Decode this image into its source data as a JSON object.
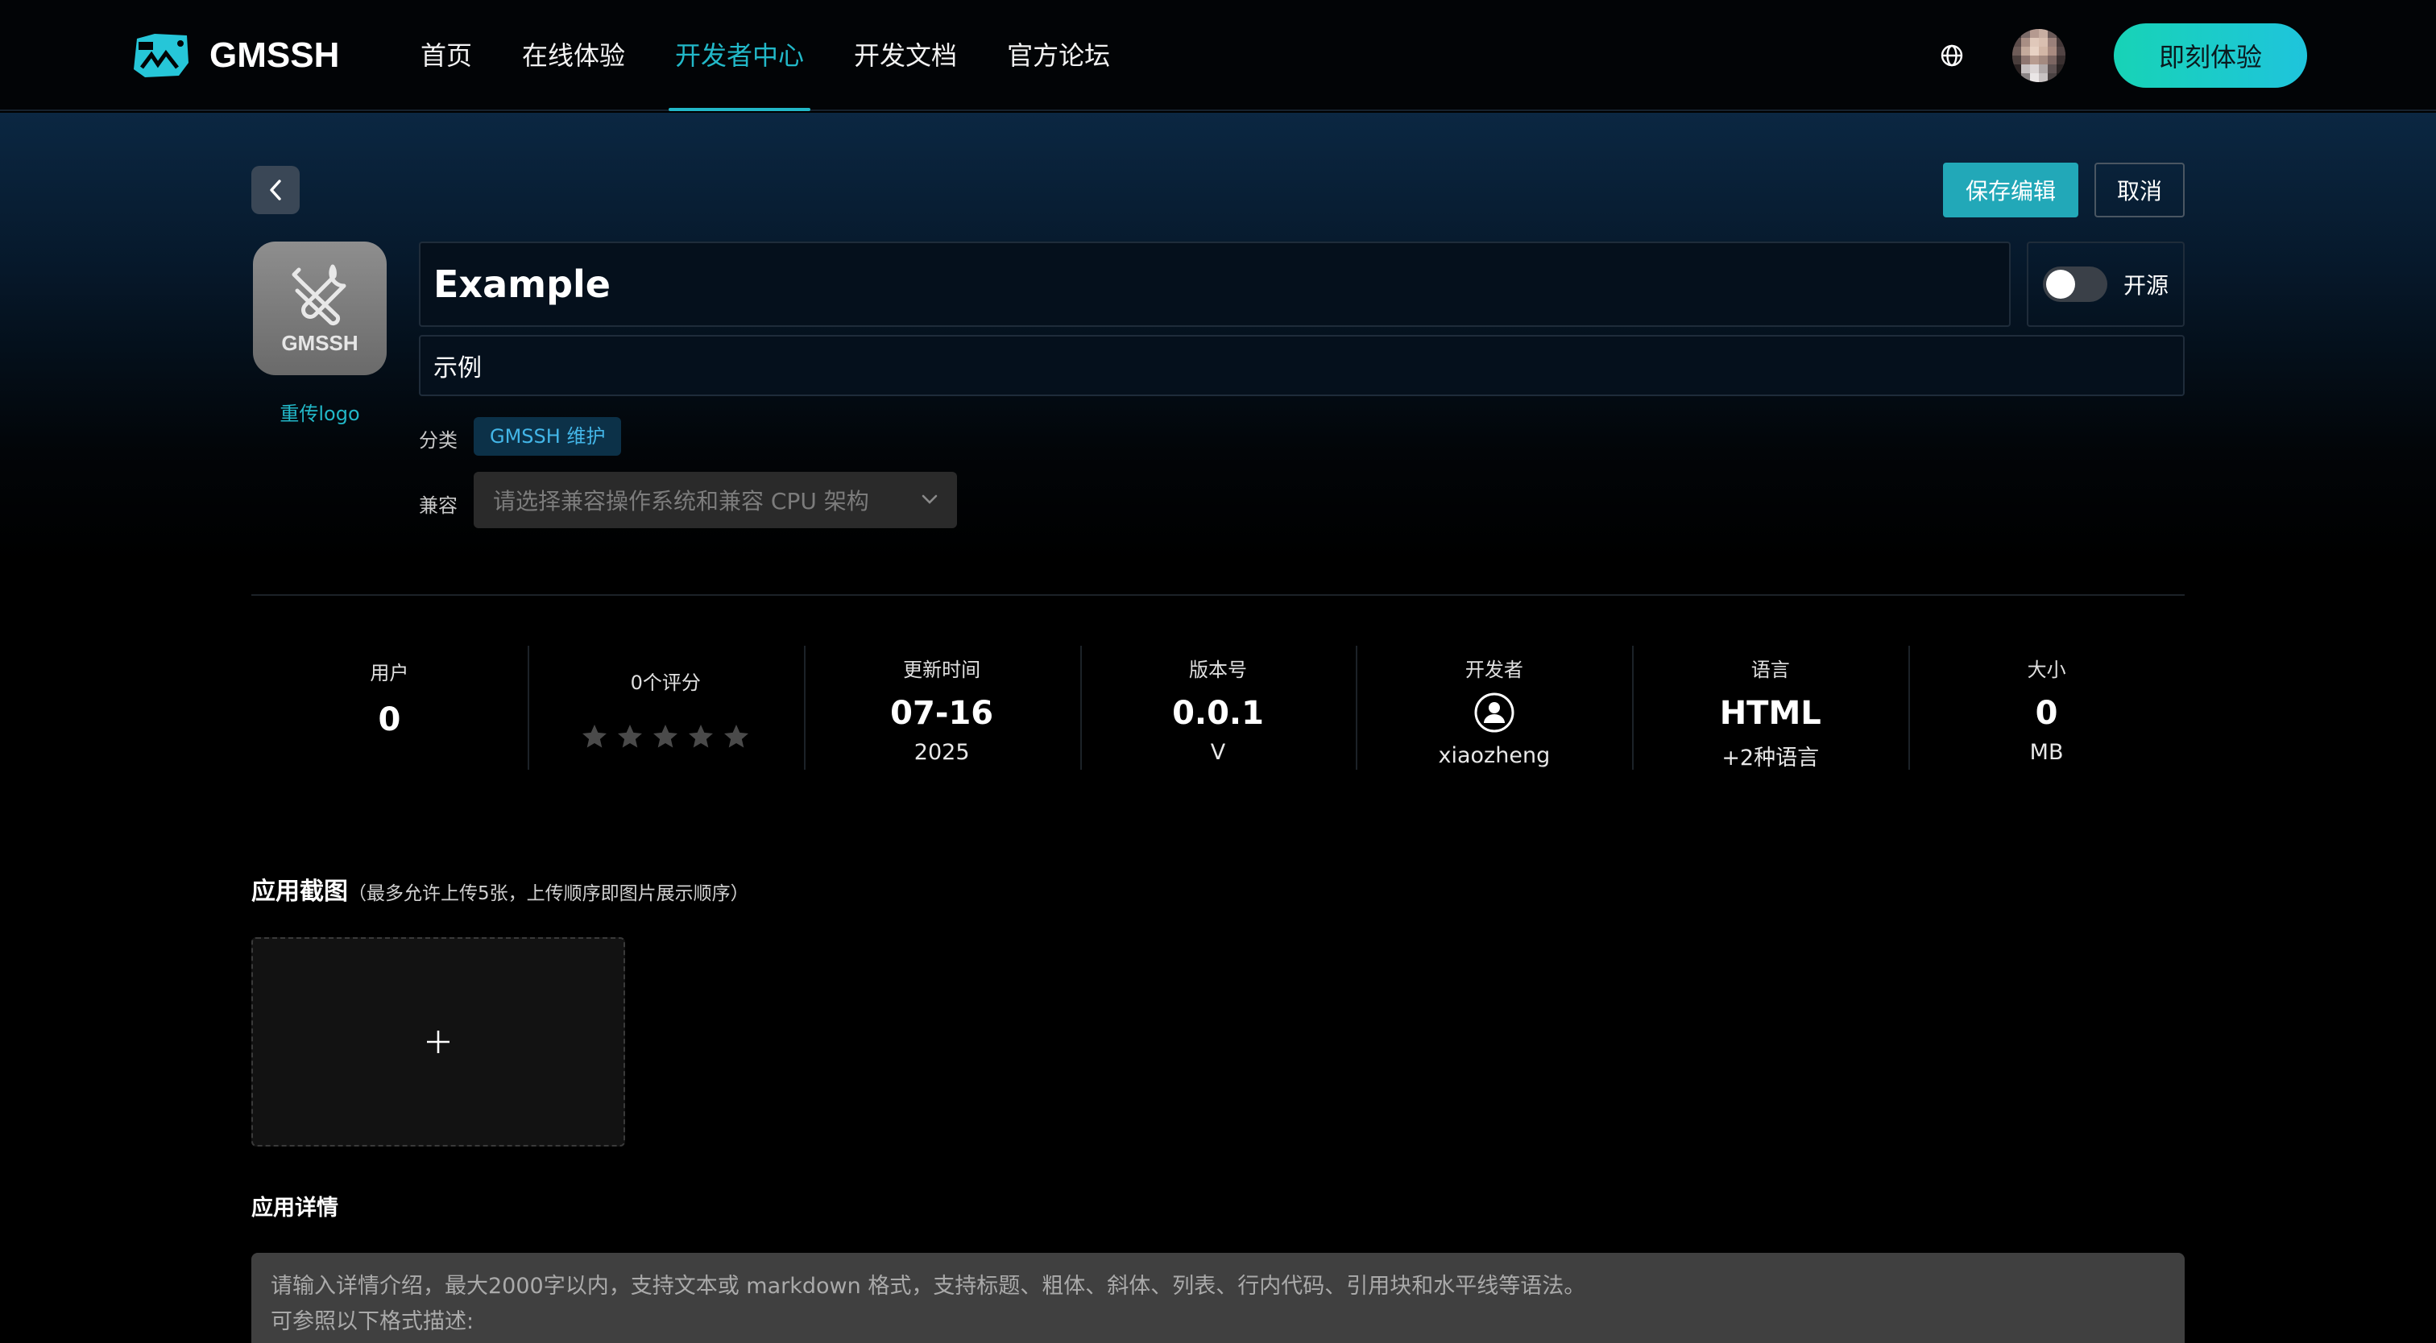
{
  "header": {
    "brand": "GMSSH",
    "nav": [
      {
        "label": "首页",
        "active": false
      },
      {
        "label": "在线体验",
        "active": false
      },
      {
        "label": "开发者中心",
        "active": true
      },
      {
        "label": "开发文档",
        "active": false
      },
      {
        "label": "官方论坛",
        "active": false
      }
    ],
    "language_icon": "globe-icon",
    "cta_label": "即刻体验",
    "accent_color": "#22b8c8"
  },
  "toolbar": {
    "back_icon": "chevron-left-icon",
    "save_label": "保存编辑",
    "cancel_label": "取消"
  },
  "app": {
    "logo_text": "GMSSH",
    "logo_icon": "tools-icon",
    "reupload_label": "重传logo",
    "name": "Example",
    "subtitle": "示例",
    "open_source_label": "开源",
    "open_source_enabled": false,
    "category_label": "分类",
    "category_tag": "GMSSH 维护",
    "compat_label": "兼容",
    "compat_placeholder": "请选择兼容操作系统和兼容 CPU 架构"
  },
  "stats": {
    "users": {
      "label": "用户",
      "value": "0"
    },
    "rating": {
      "label": "0个评分",
      "stars": 0,
      "max_stars": 5
    },
    "updated": {
      "label": "更新时间",
      "value": "07-16",
      "sub": "2025"
    },
    "version": {
      "label": "版本号",
      "value": "0.0.1",
      "sub": "V"
    },
    "developer": {
      "label": "开发者",
      "icon": "user-circle-icon",
      "sub": "xiaozheng"
    },
    "language": {
      "label": "语言",
      "value": "HTML",
      "sub": "+2种语言"
    },
    "size": {
      "label": "大小",
      "value": "0",
      "sub": "MB"
    }
  },
  "screenshots": {
    "title": "应用截图",
    "note": "（最多允许上传5张，上传顺序即图片展示顺序）",
    "add_icon": "plus-icon"
  },
  "details": {
    "title": "应用详情",
    "placeholder": "请输入详情介绍，最大2000字以内，支持文本或 markdown 格式，支持标题、粗体、斜体、列表、行内代码、引用块和水平线等语法。\n可参照以下格式描述:"
  }
}
